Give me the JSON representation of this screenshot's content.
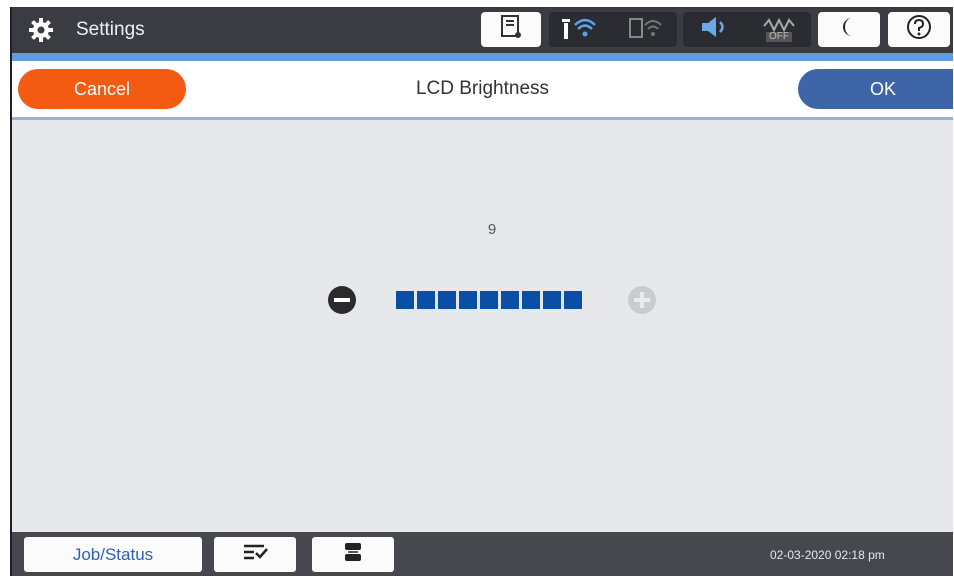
{
  "topbar": {
    "title": "Settings",
    "icons": [
      "gear-icon",
      "printer-ink-icon",
      "wifi-icon",
      "wifi-direct-icon",
      "sound-icon",
      "eco-off-icon",
      "moon-icon",
      "help-icon"
    ],
    "eco_label": "OFF"
  },
  "header": {
    "cancel_label": "Cancel",
    "title": "LCD Brightness",
    "ok_label": "OK"
  },
  "brightness": {
    "value": "9",
    "level": 9,
    "max": 9,
    "active_color": "#0b4ea6",
    "minus_icon": "minus-circle-icon",
    "plus_icon": "plus-circle-icon"
  },
  "bottombar": {
    "job_status_label": "Job/Status",
    "icons": [
      "job-list-icon",
      "printer-tray-icon"
    ],
    "datetime": "02-03-2020 02:18 pm"
  },
  "colors": {
    "topbar": "#3a3c42",
    "accent_stripe": "#5f9ce0",
    "cancel": "#f35a12",
    "ok": "#3e65a8",
    "content_bg": "#e6e8ec"
  }
}
